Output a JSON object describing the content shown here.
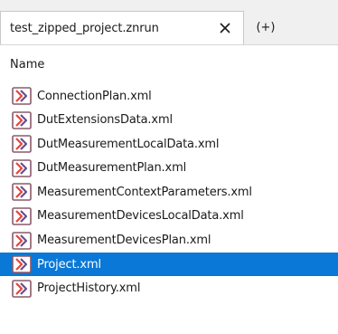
{
  "tabs": {
    "active_label": "test_zipped_project.znrun",
    "add_label": "(+)"
  },
  "list": {
    "column_header": "Name",
    "selected_index": 7,
    "items": [
      {
        "label": "ConnectionPlan.xml",
        "icon": "xml-file-icon"
      },
      {
        "label": "DutExtensionsData.xml",
        "icon": "xml-file-icon"
      },
      {
        "label": "DutMeasurementLocalData.xml",
        "icon": "xml-file-icon"
      },
      {
        "label": "DutMeasurementPlan.xml",
        "icon": "xml-file-icon"
      },
      {
        "label": "MeasurementContextParameters.xml",
        "icon": "xml-file-icon"
      },
      {
        "label": "MeasurementDevicesLocalData.xml",
        "icon": "xml-file-icon"
      },
      {
        "label": "MeasurementDevicesPlan.xml",
        "icon": "xml-file-icon"
      },
      {
        "label": "Project.xml",
        "icon": "xml-file-icon"
      },
      {
        "label": "ProjectHistory.xml",
        "icon": "xml-file-icon"
      }
    ]
  },
  "colors": {
    "selection": "#0a78d7",
    "icon_frame": "#8a5a6a",
    "icon_accent": "#e0473b"
  }
}
